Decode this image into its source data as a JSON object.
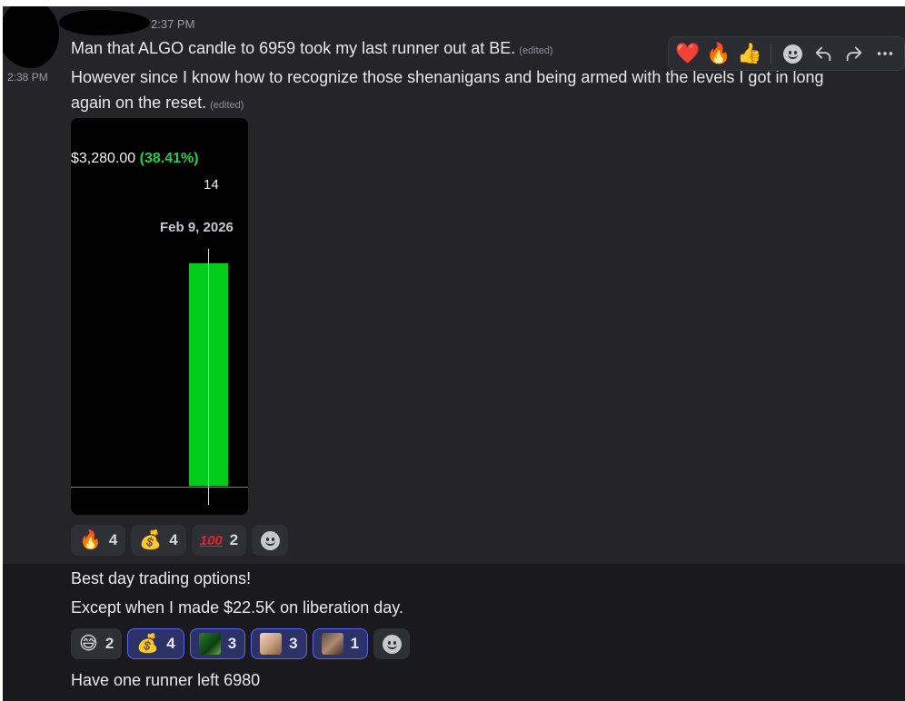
{
  "message_group": {
    "header_time": "2:37 PM"
  },
  "messages": [
    {
      "text": "Man that ALGO candle to 6959 took my last runner out at BE.",
      "edited": "(edited)"
    },
    {
      "gutter_time": "2:38 PM",
      "line1": "However since I know how to recognize those shenanigans and being armed with the levels I got in long",
      "line2": "again on the reset.",
      "edited": "(edited)"
    },
    {
      "text": "Best day trading options!"
    },
    {
      "text": "Except when I made $22.5K on liberation day."
    },
    {
      "text": "Have one runner left 6980"
    }
  ],
  "toolbar": {
    "quick_reactions": [
      "❤️",
      "🔥",
      "👍"
    ],
    "icons": [
      "add-reaction-icon",
      "reply-icon",
      "forward-icon",
      "more-icon"
    ]
  },
  "chart_image": {
    "price": "$3,280.00",
    "percent": "(38.41%)",
    "number": "14",
    "date": "Feb 9, 2026",
    "candle_color": "#00cc1a",
    "percent_color": "#21d04a"
  },
  "reactions_1": [
    {
      "emoji": "🔥",
      "count": "4"
    },
    {
      "emoji": "💰",
      "count": "4"
    },
    {
      "emoji": "100",
      "count": "2"
    }
  ],
  "reactions_2": [
    {
      "emoji": "😅",
      "count": "2"
    },
    {
      "emoji": "💰",
      "count": "4"
    },
    {
      "emoji": "custom-emoji",
      "count": "3"
    },
    {
      "emoji": "custom-emoji",
      "count": "3"
    },
    {
      "emoji": "custom-emoji",
      "count": "1"
    }
  ],
  "colors": {
    "background": "#1a1a1e",
    "hover_background": "#242429",
    "accent": "#5865f2"
  }
}
